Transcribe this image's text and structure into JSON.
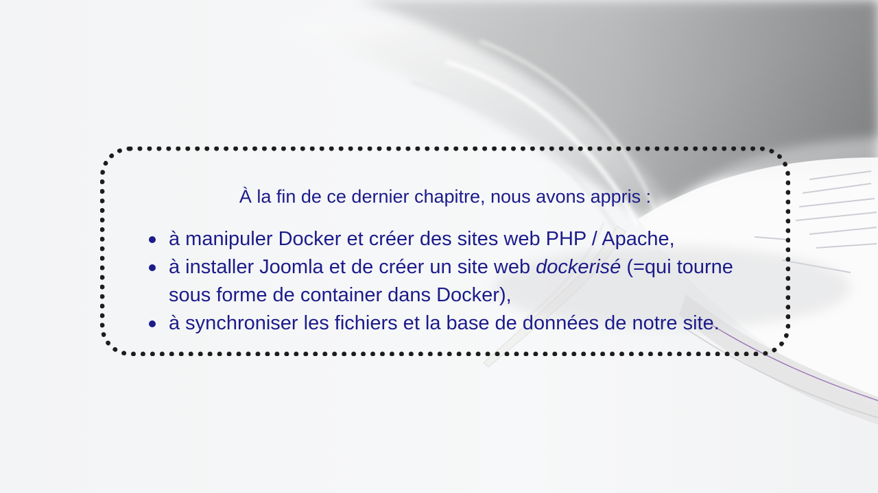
{
  "summary": {
    "intro": "À la fin de ce dernier chapitre, nous avons appris :",
    "items": [
      {
        "text": "à manipuler Docker et créer des sites web PHP / Apache,"
      },
      {
        "before": "à installer Joomla et de créer un site web ",
        "emphasis": "dockerisé",
        "after": " (=qui tourne sous forme de container dans Docker),"
      },
      {
        "text": "à synchroniser les fichiers et la base de données de notre site."
      }
    ]
  },
  "colors": {
    "text": "#1b1b8a",
    "border": "#1d1d1d",
    "background": "#f6f7f8"
  }
}
